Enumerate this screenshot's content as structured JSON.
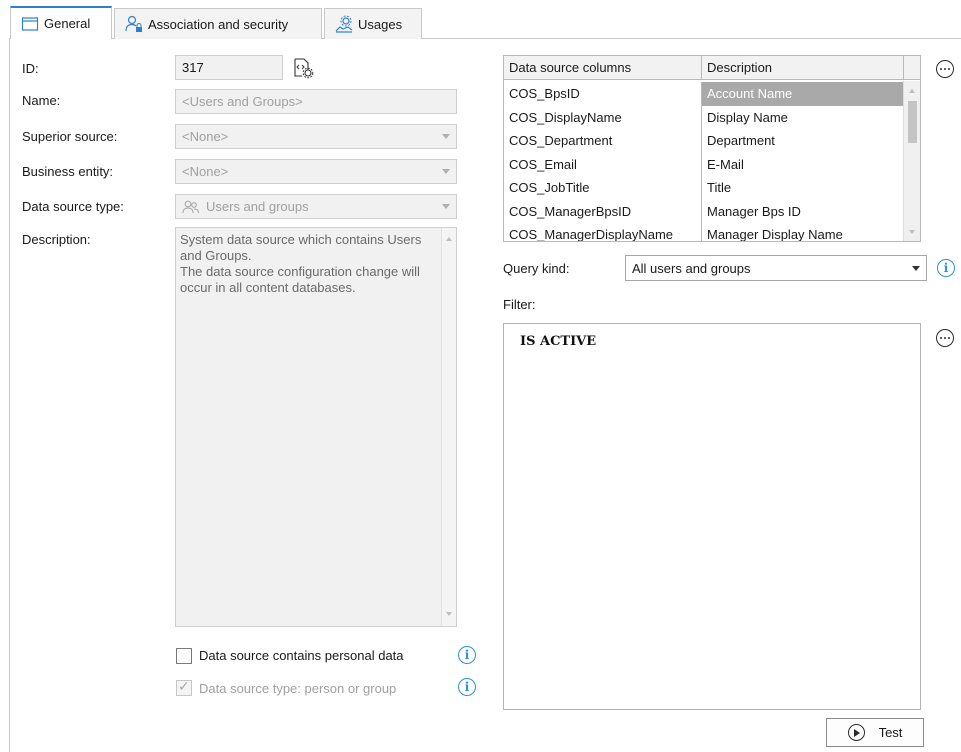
{
  "tabs": [
    {
      "label": "General",
      "icon": "window-icon",
      "active": true
    },
    {
      "label": "Association and security",
      "icon": "user-lock-icon",
      "active": false
    },
    {
      "label": "Usages",
      "icon": "usage-gear-icon",
      "active": false
    }
  ],
  "form": {
    "id_label": "ID:",
    "id_value": "317",
    "name_label": "Name:",
    "name_value": "<Users and Groups>",
    "superior_label": "Superior source:",
    "superior_value": "<None>",
    "business_label": "Business entity:",
    "business_value": "<None>",
    "type_label": "Data source type:",
    "type_value": "Users and groups",
    "description_label": "Description:",
    "description_value": "System data source which contains Users and Groups.\nThe data source configuration change will occur in all content databases.",
    "personal_data_label": "Data source contains personal data",
    "personal_data_checked": false,
    "person_group_label": "Data source type: person or group",
    "person_group_checked": true
  },
  "grid": {
    "headers": [
      "Data source columns",
      "Description"
    ],
    "rows": [
      {
        "column": "COS_BpsID",
        "description": "Account Name",
        "selected": true
      },
      {
        "column": "COS_DisplayName",
        "description": "Display Name"
      },
      {
        "column": "COS_Department",
        "description": "Department"
      },
      {
        "column": "COS_Email",
        "description": "E-Mail"
      },
      {
        "column": "COS_JobTitle",
        "description": "Title"
      },
      {
        "column": "COS_ManagerBpsID",
        "description": "Manager Bps ID"
      },
      {
        "column": "COS_ManagerDisplayName",
        "description": "Manager Display Name"
      }
    ]
  },
  "query": {
    "label": "Query kind:",
    "value": "All users and groups"
  },
  "filter": {
    "label": "Filter:",
    "text": "IS ACTIVE"
  },
  "test_button": {
    "label": "Test"
  },
  "colors": {
    "accent": "#2f7fd1",
    "info": "#2f8fe0",
    "selection": "#a9a9a9"
  }
}
